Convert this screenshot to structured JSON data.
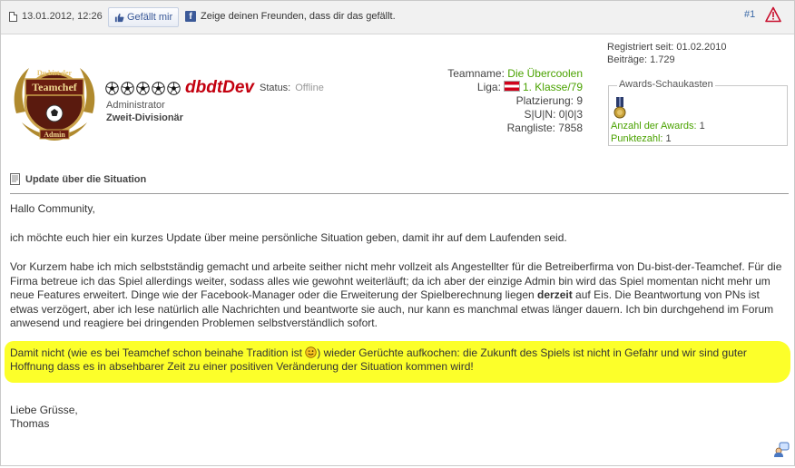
{
  "header": {
    "date": "13.01.2012, 12:26",
    "like_label": "Gefällt mir",
    "share_text": "Zeige deinen Freunden, dass dir das gefällt.",
    "post_number": "#1"
  },
  "user": {
    "avatar_text_top": "Du bist der",
    "avatar_text_mid": "Teamchef",
    "avatar_text_bottom": "Admin",
    "username": "dbdtDev",
    "status_label": "Status:",
    "status_value": "Offline",
    "role": "Administrator",
    "division": "Zweit-Divisionär",
    "ball_count": 5
  },
  "team": {
    "teamname_label": "Teamname:",
    "teamname_value": "Die Übercoolen",
    "liga_label": "Liga:",
    "liga_value": "1. Klasse/79",
    "placement": "Platzierung: 9",
    "record": "S|U|N: 0|0|3",
    "ranking": "Rangliste: 7858"
  },
  "registration": {
    "registered": "Registriert seit: 01.02.2010",
    "posts": "Beiträge: 1.729"
  },
  "awards": {
    "legend": "Awards-Schaukasten",
    "count_label": "Anzahl der Awards:",
    "count_value": "1",
    "points_label": "Punktezahl:",
    "points_value": "1"
  },
  "post": {
    "title": "Update über die Situation",
    "greeting": "Hallo Community,",
    "intro": "ich möchte euch hier ein kurzes Update über meine persönliche Situation geben, damit ihr auf dem Laufenden seid.",
    "para1_a": "Vor Kurzem habe ich mich selbstständig gemacht und arbeite seither nicht mehr vollzeit als Angestellter für die Betreiberfirma von Du-bist-der-Teamchef. Für die Firma betreue ich das Spiel allerdings weiter, sodass alles wie gewohnt weiterläuft; da ich aber der einzige Admin bin wird das Spiel momentan nicht mehr um neue Features erweitert. Dinge wie der Facebook-Manager oder die Erweiterung der Spielberechnung liegen",
    "para1_bold": "derzeit",
    "para1_b": "auf Eis. Die Beantwortung von PNs ist etwas verzögert, aber ich lese natürlich alle Nachrichten und beantworte sie auch, nur kann es manchmal etwas länger dauern. Ich bin durchgehend im Forum anwesend und reagiere bei dringenden Problemen selbstverständlich sofort.",
    "highlight_a": "Damit nicht (wie es bei Teamchef schon beinahe Tradition ist",
    "highlight_b": ") wieder Gerüchte aufkochen: die Zukunft des Spiels ist nicht in Gefahr und wir sind guter Hoffnung dass es in absehbarer Zeit zu einer positiven Veränderung der Situation kommen wird!",
    "closing": "Liebe Grüsse,",
    "signature": "Thomas"
  },
  "colors": {
    "highlight": "#fcff2a",
    "username": "#c3000f",
    "link_green": "#4aa200",
    "facebook": "#3b5998"
  }
}
